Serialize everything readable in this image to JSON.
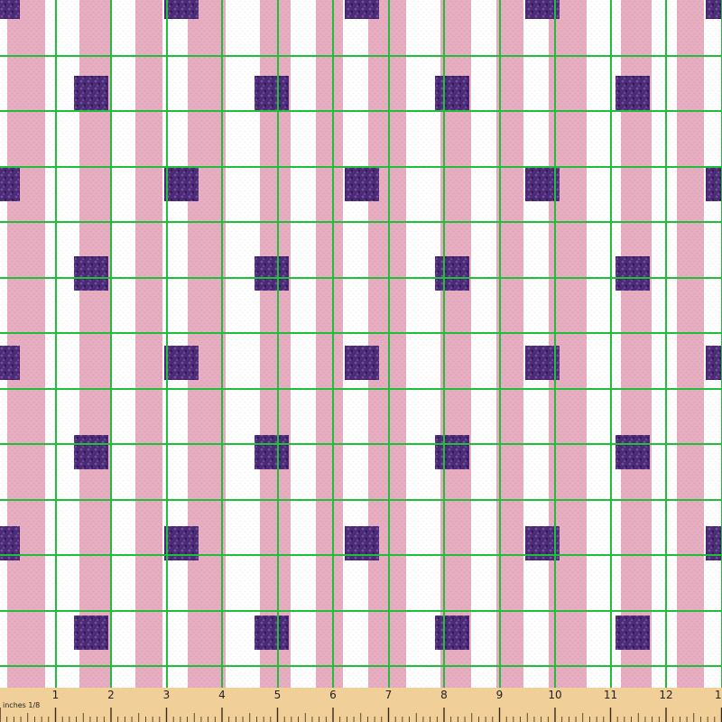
{
  "image": {
    "subject": "Fabric swatch with pink and white vertical stripes and purple glitter squares, overlaid with a green measurement grid and an inch ruler",
    "colors": {
      "white": "#ffffff",
      "pink": "#e7adc0",
      "pink_texture": "#d996ad",
      "purple": "#4b2a76",
      "purple_highlight": "#7b56a8",
      "purple_dark": "#2f1550",
      "grid_green": "#1fbf3a",
      "ruler_wood": "#f0cf98",
      "ruler_tick": "#3a2a1a"
    }
  },
  "ruler": {
    "unit_label": "inches 1/8",
    "ticks": [
      "1",
      "2",
      "3",
      "4",
      "5",
      "6",
      "7",
      "8",
      "9",
      "10",
      "11",
      "12",
      "13"
    ]
  }
}
